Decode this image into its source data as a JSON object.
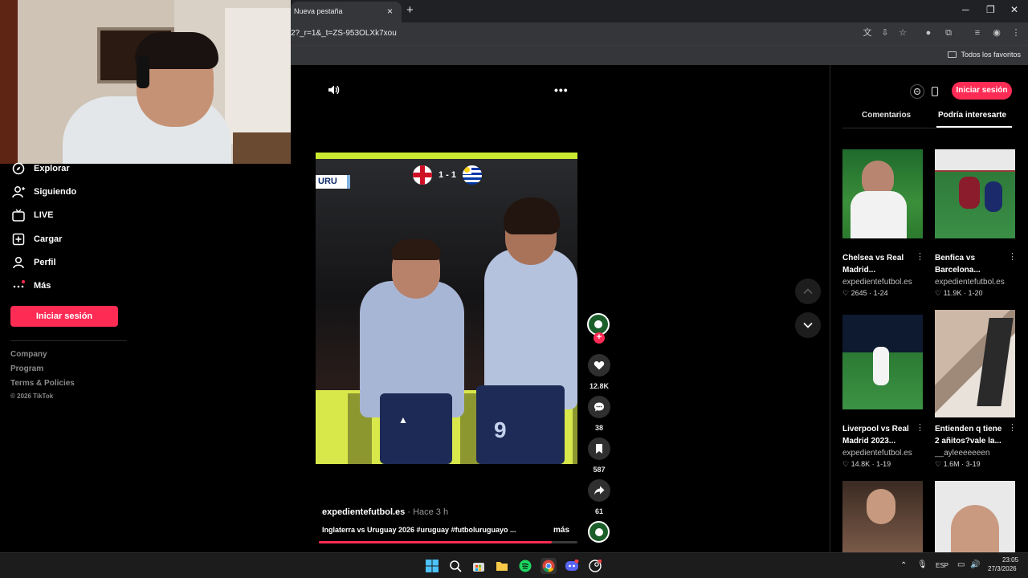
{
  "browser": {
    "tab_title": "Nueva pestaña",
    "tab_close": "×",
    "new_tab": "+",
    "url": "2?_r=1&_t=ZS-953OLXk7xou",
    "bookmarks_label": "Todos los favoritos",
    "window_controls": [
      "─",
      "❐",
      "✕"
    ]
  },
  "nav": {
    "items": [
      {
        "label": "Explorar",
        "icon": "compass-icon"
      },
      {
        "label": "Siguiendo",
        "icon": "user-follow-icon"
      },
      {
        "label": "LIVE",
        "icon": "live-tv-icon"
      },
      {
        "label": "Cargar",
        "icon": "upload-plus-icon"
      },
      {
        "label": "Perfil",
        "icon": "profile-icon"
      },
      {
        "label": "Más",
        "icon": "more-dots-icon"
      }
    ],
    "login_label": "Iniciar sesión",
    "footer_links": [
      "Company",
      "Program",
      "Terms & Policies"
    ],
    "copyright": "© 2026 TikTok"
  },
  "video": {
    "team_tag": "URU",
    "score": "1 - 1",
    "author": "expedientefutbol.es",
    "time": " · Hace 3 h",
    "caption": "Inglaterra vs Uruguay 2026 #uruguay #futboluruguayo ...",
    "more_label": "más",
    "progress": 0.9,
    "jersey_number": "9"
  },
  "actions": {
    "likes": "12.8K",
    "comments": "38",
    "saves": "587",
    "shares": "61",
    "follow_plus": "+"
  },
  "right_panel": {
    "login_label": "Iniciar sesión",
    "tabs": [
      "Comentarios",
      "Podría interesarte"
    ],
    "active_tab": "Podría interesarte",
    "cards": [
      {
        "title": "Chelsea vs Real Madrid...",
        "user": "expedientefutbol.es",
        "likes": "2645",
        "date": "1-24"
      },
      {
        "title": "Benfica vs Barcelona...",
        "user": "expedientefutbol.es",
        "likes": "11.9K",
        "date": "1-20"
      },
      {
        "title": "Liverpool vs Real Madrid 2023...",
        "user": "expedientefutbol.es",
        "likes": "14.8K",
        "date": "1-19"
      },
      {
        "title": "Entienden q tiene 2 añitos?vale la...",
        "user": "__ayleeeeeeen",
        "likes": "1.6M",
        "date": "3-19"
      }
    ],
    "more_glyph": "⋮",
    "heart_glyph": "♡",
    "dot": "·"
  },
  "taskbar": {
    "language": "ESP",
    "time": "23:05",
    "date": "27/3/2026",
    "apps": [
      "windows-start-icon",
      "search-icon",
      "store-icon",
      "file-explorer-icon",
      "spotify-icon",
      "chrome-icon",
      "discord-icon",
      "steam-icon"
    ]
  },
  "colors": {
    "accent": "#fe2c55",
    "background": "#000000",
    "chrome": "#202124"
  }
}
